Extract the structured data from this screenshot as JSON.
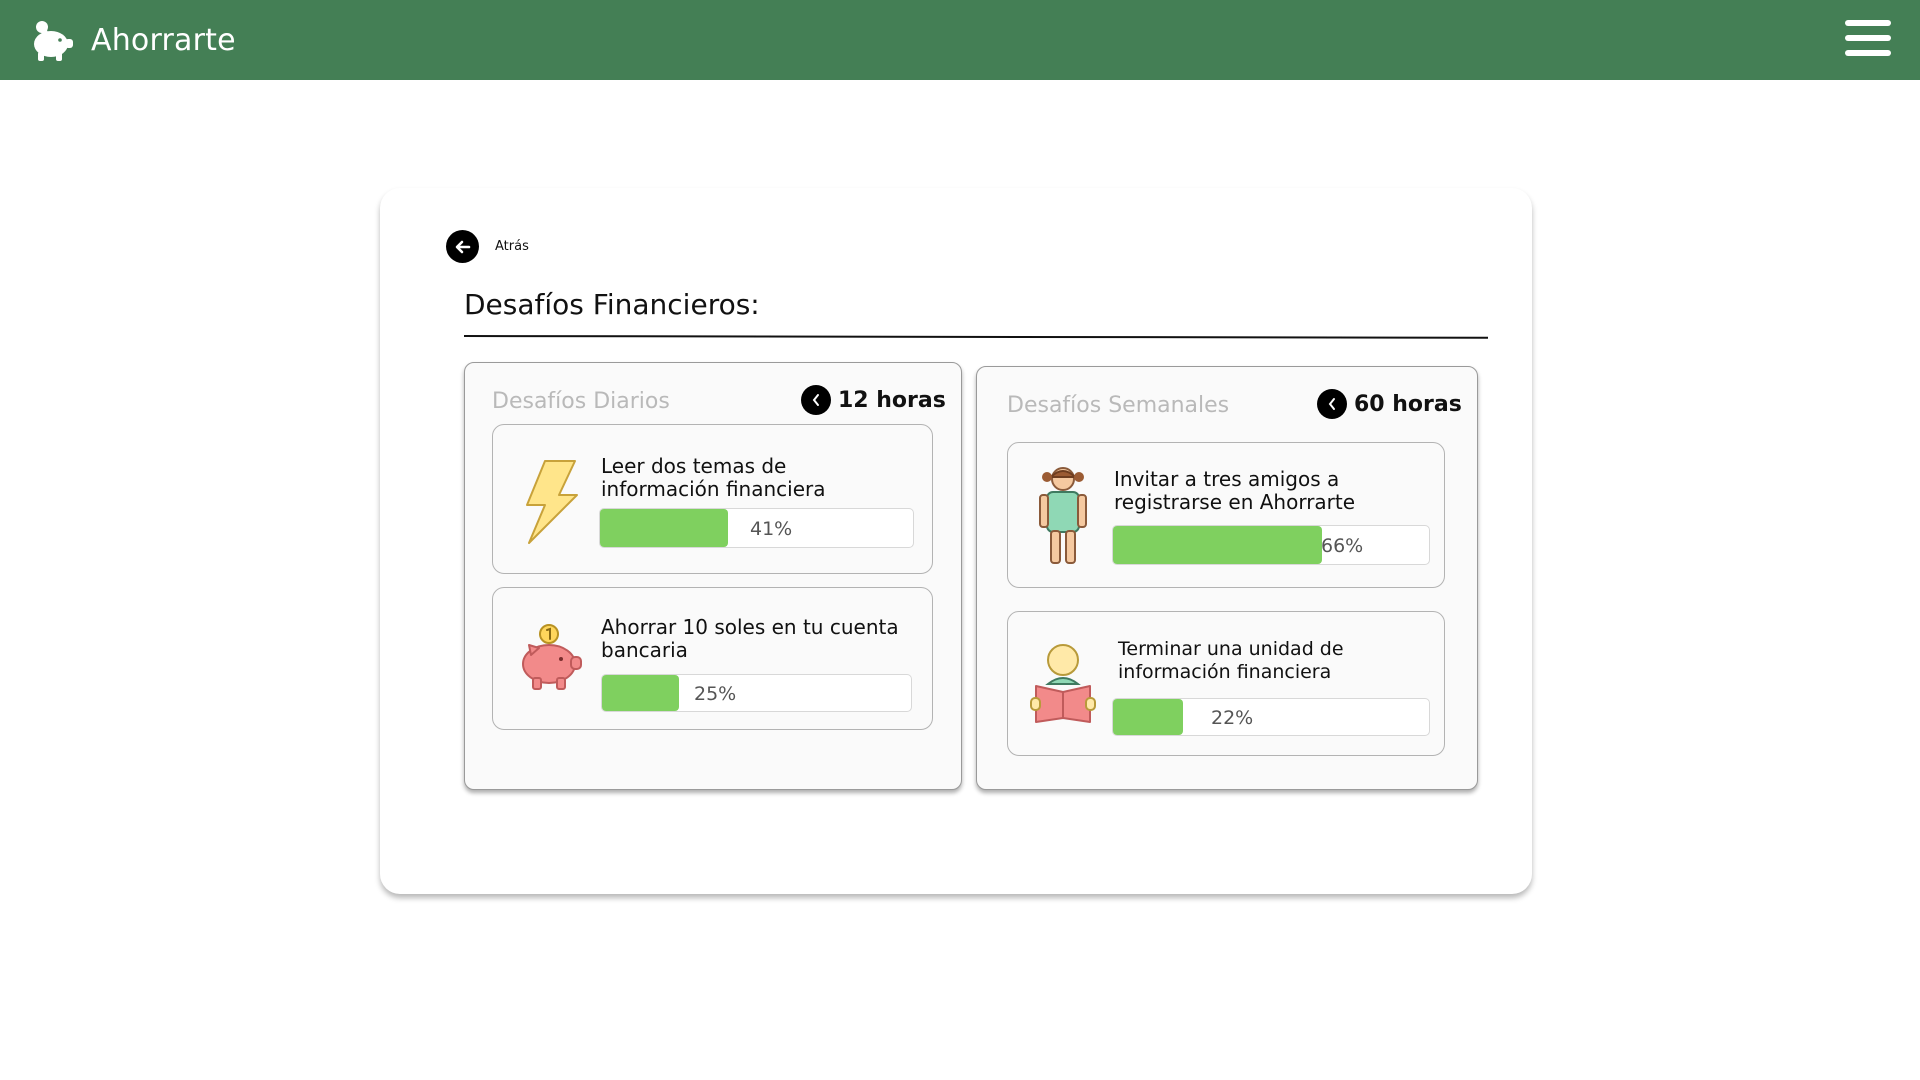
{
  "app": {
    "name": "Ahorrarte",
    "logo_icon": "piggy-bank-icon",
    "menu_icon": "hamburger-menu-icon",
    "brand_color": "#447f55"
  },
  "back": {
    "label": "Atrás",
    "icon": "arrow-left-icon"
  },
  "page": {
    "title": "Desafíos Financieros:"
  },
  "daily": {
    "title": "Desafíos Diarios",
    "timer_icon": "clock-icon",
    "timer": "12 horas",
    "challenges": [
      {
        "icon": "lightning-bolt-icon",
        "text": "Leer dos temas de información financiera",
        "progress": 41,
        "progress_label": "41%"
      },
      {
        "icon": "piggy-bank-coin-icon",
        "text": "Ahorrar 10 soles en tu cuenta bancaria",
        "progress": 25,
        "progress_label": "25%"
      }
    ]
  },
  "weekly": {
    "title": "Desafíos Semanales",
    "timer_icon": "clock-icon",
    "timer": "60 horas",
    "challenges": [
      {
        "icon": "girl-icon",
        "text": "Invitar a tres amigos a registrarse en Ahorrarte",
        "progress": 66,
        "progress_label": "66%"
      },
      {
        "icon": "reading-person-icon",
        "text": "Terminar una unidad de información financiera",
        "progress": 22,
        "progress_label": "22%"
      }
    ]
  },
  "colors": {
    "progress_fill": "#7fd05f",
    "panel_title": "#b9b9b9"
  }
}
